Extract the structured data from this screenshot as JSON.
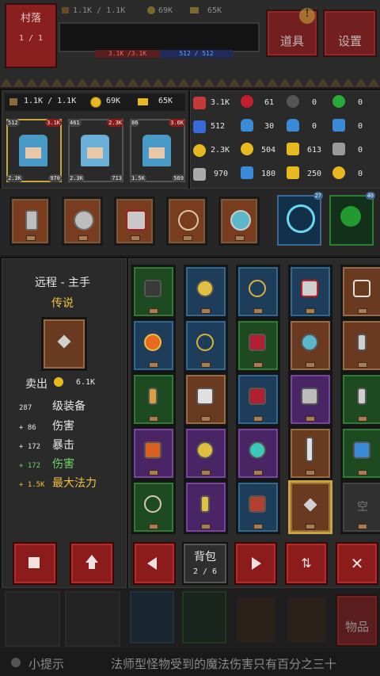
{
  "header": {
    "village_label": "村落",
    "village_level": "1 / 1",
    "food": "1.1K / 1.1K",
    "gold": "69K",
    "crown": "65K",
    "hp_bar": "3.1K /3.1K",
    "mp_bar": "512 / 512",
    "items_button": "道具",
    "settings_button": "设置"
  },
  "party": {
    "food": "1.1K / 1.1K",
    "gold": "69K",
    "crown": "65K",
    "heroes": [
      {
        "level": "512",
        "hp": "3.1K",
        "atk": "2.3K",
        "def": "970",
        "selected": true
      },
      {
        "level": "461",
        "hp": "2.3K",
        "atk": "2.3K",
        "def": "713"
      },
      {
        "level": "86",
        "hp": "3.6K",
        "atk": "1.5K",
        "def": "569"
      }
    ]
  },
  "stats": {
    "max_hp": "3.1K",
    "hp_regen": "61",
    "unknown1": "0",
    "green_heart": "0",
    "max_mp": "512",
    "mp_potion": "30",
    "mp_potion2": "0",
    "blue_cross": "0",
    "atk": "2.3K",
    "coin_stat": "504",
    "gold_cross": "613",
    "shield_stat": "0",
    "def": "970",
    "blue_gem": "180",
    "shield2": "250",
    "yellow_heart": "0"
  },
  "equipped": {
    "pet1_level": "27",
    "pet2_level": "40"
  },
  "detail": {
    "slot_type": "远程 - 主手",
    "rarity": "传说",
    "sell_label": "卖出",
    "sell_price": "6.1K",
    "lines": [
      {
        "amt": "287",
        "text": "级装备",
        "color": "#e8e8e8"
      },
      {
        "amt": "+ 86",
        "text": "伤害",
        "color": "#e8e8e8"
      },
      {
        "amt": "+ 172",
        "text": "暴击",
        "color": "#e8e8e8"
      },
      {
        "amt": "+ 172",
        "text": "伤害",
        "color": "#6fd36a"
      },
      {
        "amt": "+ 1.5K",
        "text": "最大法力",
        "color": "#f0c040"
      }
    ]
  },
  "inventory": {
    "bag_label": "背包",
    "page": "2 / 6",
    "empty_label": "空"
  },
  "bottom": {
    "items_label": "物品",
    "tip_label": "小提示",
    "tip_text": "法师型怪物受到的魔法伤害只有百分之三十"
  },
  "colors": {
    "red_button": "#8c1b1b",
    "gold_highlight": "#c8a63c",
    "green_text": "#6fd36a",
    "yellow_text": "#f0c040",
    "rarity": "#f0c040"
  }
}
